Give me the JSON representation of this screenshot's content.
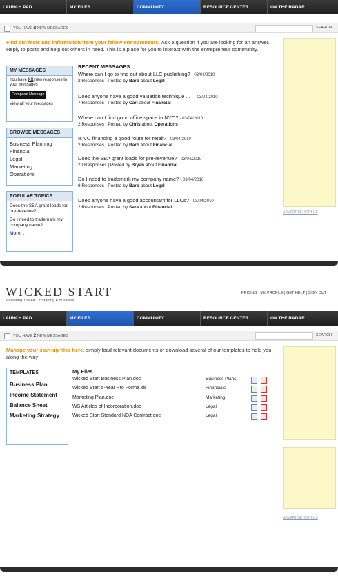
{
  "nav": [
    "LAUNCH PAD",
    "MY FILES",
    "COMMUNITY",
    "RESOURCE CENTER",
    "ON THE RADAR"
  ],
  "notice": {
    "prefix": "YOU HAVE",
    "count": "2",
    "suffix": "NEW MESSAGES",
    "search_label": "SEARCH"
  },
  "community": {
    "intro_highlight": "Find out facts and information from your fellow entrepreneurs.",
    "intro_rest": "Ask a question if you are looking for an answer. Reply to posts and help out others in need. This is a place for you to interact with the entrepreneur community.",
    "my_messages": {
      "title": "MY MESSAGES",
      "line1": "You have",
      "xx": "XX",
      "line1b": "new responses to your messages",
      "compose": "Compose Message",
      "view_all": "View all your messages"
    },
    "browse": {
      "title": "BROWSE MESSAGES",
      "items": [
        "Business Planning",
        "Financial",
        "Legal",
        "Marketing",
        "Operations"
      ]
    },
    "popular": {
      "title": "POPULAR TOPICS",
      "items": [
        "Does the SBA grant loads for pre-revenue?",
        "Do I need to trademark my company name?"
      ],
      "more": "More. . ."
    },
    "recent_title": "RECENT MESSAGES",
    "messages": [
      {
        "q": "Where can I go to find out about LLC publishing?",
        "date": "- 03/04/2010",
        "responses": "2 Responses",
        "by": "Posted by",
        "author": "Barb",
        "about": "about",
        "cat": "Legal"
      },
      {
        "q": "Does anyone have a good valuation technique . . .",
        "date": "- 03/04/2010",
        "responses": "7 Responses",
        "by": "Posted by",
        "author": "Carl",
        "about": "about",
        "cat": "Financial"
      },
      {
        "q": "Where can I find good office space in NYC?",
        "date": "- 03/04/2010",
        "responses": "2 Responses",
        "by": "Posted by",
        "author": "Chris",
        "about": "about",
        "cat": "Operations"
      },
      {
        "q": "Is VC financing a good route for retail?",
        "date": "- 03/04/2010",
        "responses": "2 Responses",
        "by": "Posted by",
        "author": "Barb",
        "about": "about",
        "cat": "Financial"
      },
      {
        "q": "Does the SBA grant loads for pre-revenue?",
        "date": "- 03/04/2010",
        "responses": "20 Responses",
        "by": "Posted by",
        "author": "Bryan",
        "about": "about",
        "cat": "Financial"
      },
      {
        "q": "Do I need to trademark my company name?",
        "date": "- 03/04/2010",
        "responses": "8 Responses",
        "by": "Posted by",
        "author": "Barb",
        "about": "about",
        "cat": "Legal"
      },
      {
        "q": "Does anyone have a good accountant for LLCs?",
        "date": "- 03/04/2010",
        "responses": "2 Responses",
        "by": "Posted by",
        "author": "Sara",
        "about": "about",
        "cat": "Financial"
      }
    ],
    "advertise": "ADVERTISE WITH US"
  },
  "brand": {
    "logo": "WICKED START",
    "tagline": "Mastering The Art Of Starting A Business",
    "links": "PRICING | MY PROFILE | GET HELP | SIGN OUT"
  },
  "files": {
    "intro_highlight": "Manage your start-up files here,",
    "intro_rest": "simply load relevant documents or download several of our templates to help you along the way",
    "templates_title": "TEMPLATES",
    "templates": [
      "Business Plan",
      "Income Statement",
      "Balance Sheet",
      "Marketing Strategy"
    ],
    "my_files_title": "My Files",
    "rows": [
      {
        "name": "Wicked Start Business Plan.doc",
        "cat": "Business Plans",
        "icon": "word-icon"
      },
      {
        "name": "Wicked Start 5-Year Pro Forma.xls",
        "cat": "Financials",
        "icon": "excel-icon"
      },
      {
        "name": "Marketing Plan.doc",
        "cat": "Marketing",
        "icon": "word-icon"
      },
      {
        "name": "WS Articles of Incorporation.doc",
        "cat": "Legal",
        "icon": "word-icon"
      },
      {
        "name": "Wicked Start Standard NDA Contract.doc",
        "cat": "Legal",
        "icon": "word-icon"
      }
    ],
    "advertise": "ADVERTISE WITH US"
  }
}
